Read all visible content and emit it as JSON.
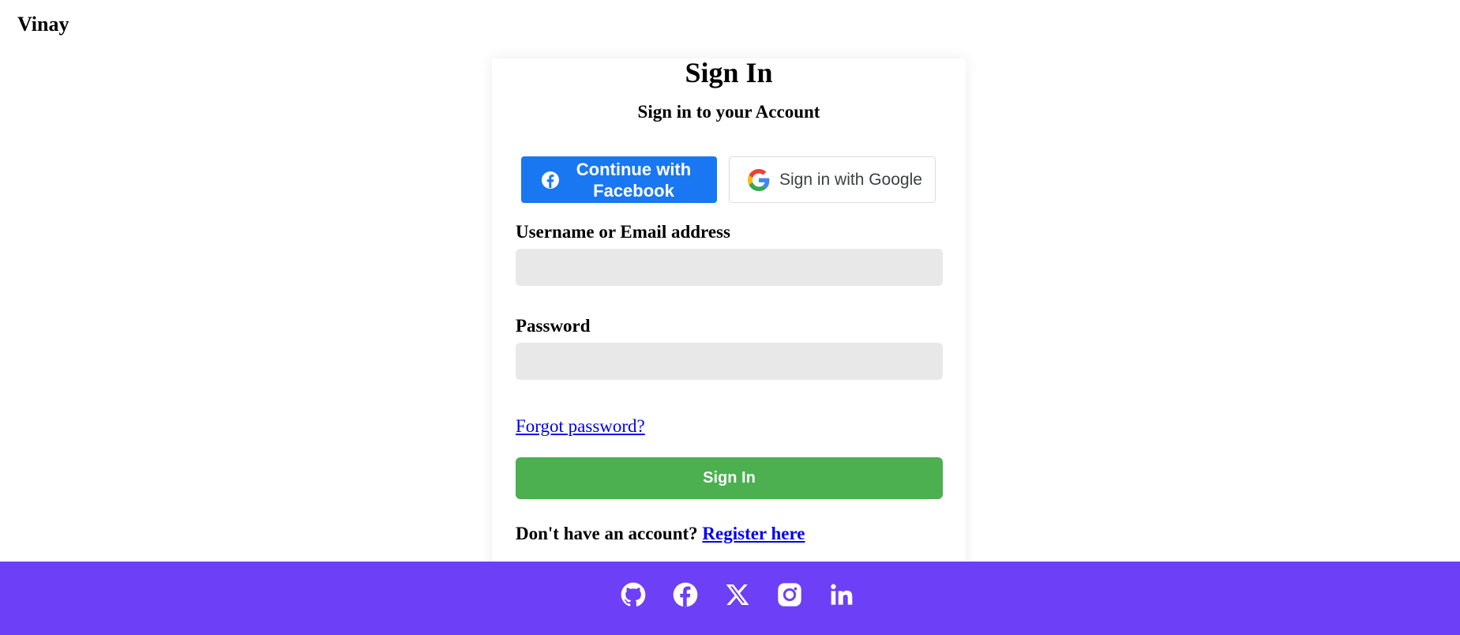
{
  "brand": {
    "name": "Vinay"
  },
  "signin_card": {
    "title": "Sign In",
    "subtitle": "Sign in to your Account",
    "facebook_button_label": "Continue with Facebook",
    "google_button_label": "Sign in with Google",
    "username_label": "Username or Email address",
    "username_value": "",
    "password_label": "Password",
    "password_value": "",
    "forgot_password_link": "Forgot password?",
    "submit_button_label": "Sign In",
    "register_prompt": "Don't have an account?",
    "register_link": "Register here"
  },
  "footer": {
    "social_icons": [
      "github-icon",
      "facebook-icon",
      "x-icon",
      "instagram-icon",
      "linkedin-icon"
    ]
  },
  "colors": {
    "facebook_blue": "#1a77f2",
    "signin_green": "#4caf50",
    "footer_purple": "#6d3ff6",
    "link_blue": "#0000ee",
    "input_bg": "#e8e8e8"
  }
}
